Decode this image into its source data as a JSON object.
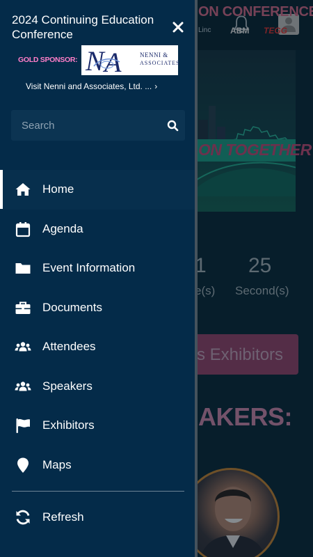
{
  "drawer": {
    "title": "2024 Continuing Education Conference",
    "close_icon": "close-icon",
    "sponsor": {
      "label": "GOLD SPONSOR:",
      "logo_monogram": "N|A",
      "logo_name_line1": "NENNI &",
      "logo_name_line2": "ASSOCIATES",
      "link_text": "Visit Nenni and Associates, Ltd. ...",
      "link_chevron": "›"
    },
    "search": {
      "placeholder": "Search",
      "value": "",
      "icon": "search-icon"
    },
    "nav_items": [
      {
        "label": "Home",
        "icon": "home-icon",
        "active": true
      },
      {
        "label": "Agenda",
        "icon": "calendar-icon",
        "active": false
      },
      {
        "label": "Event Information",
        "icon": "folder-icon",
        "active": false
      },
      {
        "label": "Documents",
        "icon": "briefcase-icon",
        "active": false
      },
      {
        "label": "Attendees",
        "icon": "users-icon",
        "active": false
      },
      {
        "label": "Speakers",
        "icon": "users-icon",
        "active": false
      },
      {
        "label": "Exhibitors",
        "icon": "flag-icon",
        "active": false
      },
      {
        "label": "Maps",
        "icon": "map-pin-icon",
        "active": false
      }
    ],
    "refresh": {
      "label": "Refresh",
      "icon": "refresh-icon"
    }
  },
  "background": {
    "banner_title_fragment": "ON CONFERENCE",
    "sponsor_logos": [
      "Linc",
      "ABM",
      "TEGG"
    ],
    "banner_ribbon_fragment": "ON TOGETHER",
    "countdown": [
      {
        "value": "1",
        "unit": "e(s)"
      },
      {
        "value": "25",
        "unit": "Second(s)"
      }
    ],
    "exhibitors_button_fragment": "s Exhibitors",
    "speakers_heading_fragment": "AKERS:"
  },
  "colors": {
    "drawer_bg": "#042b49",
    "sponsor_label": "#ff7ec8",
    "search_bg": "#0c3452",
    "accent_ribbon": "#1fa38a",
    "exhibitors_button": "#9a4a72"
  }
}
